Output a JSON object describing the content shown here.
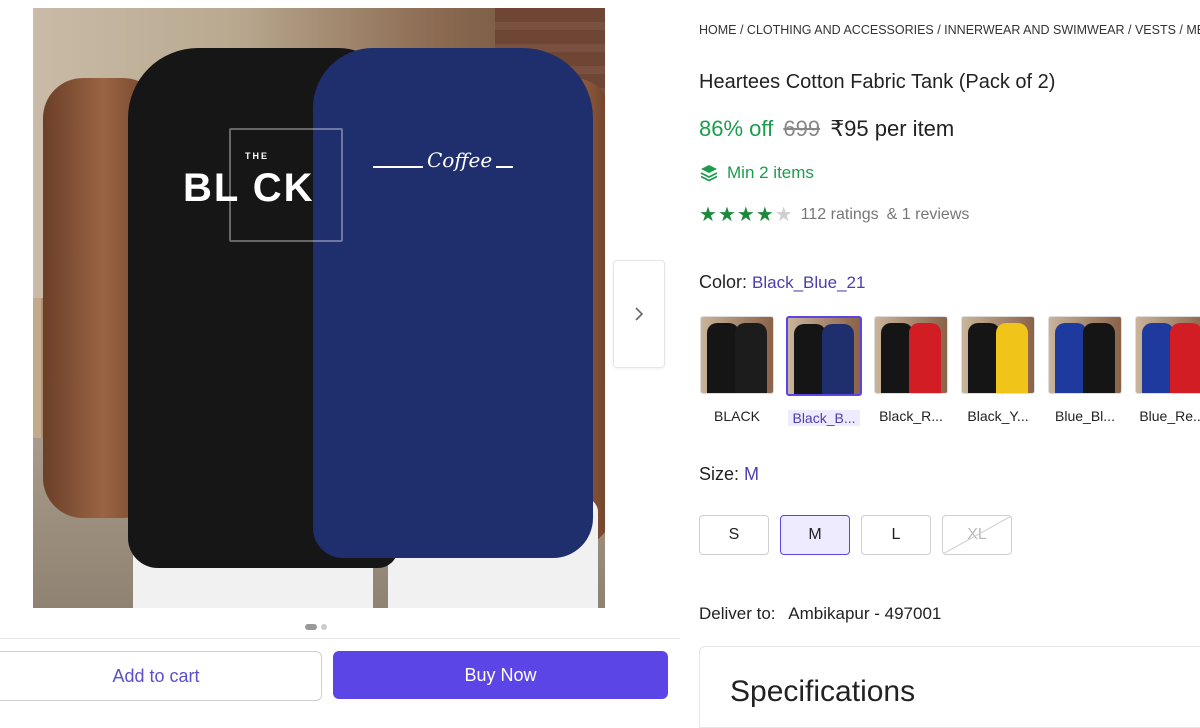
{
  "gallery": {
    "prints": {
      "black_word": "BL CK",
      "black_the": "THE",
      "blue_word": "Coffee"
    }
  },
  "actions": {
    "add_to_cart": "Add to cart",
    "buy_now": "Buy Now"
  },
  "product": {
    "breadcrumb": "HOME / CLOTHING AND ACCESSORIES / INNERWEAR AND SWIMWEAR / VESTS / ME",
    "title": "Heartees Cotton Fabric Tank (Pack of 2)",
    "discount": "86% off",
    "mrp": "699",
    "price": "₹95 per item",
    "min_items": "Min 2 items",
    "rating": {
      "value": 4,
      "max": 5,
      "ratings_text": "112 ratings",
      "reviews_text": "& 1 reviews"
    },
    "color": {
      "label": "Color:",
      "selected": "Black_Blue_21",
      "options": [
        {
          "caption": "BLACK",
          "c1": "#151515",
          "c2": "#1c1c1c",
          "selected": false
        },
        {
          "caption": "Black_B...",
          "c1": "#151515",
          "c2": "#1f2f6e",
          "selected": true
        },
        {
          "caption": "Black_R...",
          "c1": "#151515",
          "c2": "#d11d23",
          "selected": false
        },
        {
          "caption": "Black_Y...",
          "c1": "#151515",
          "c2": "#f0c419",
          "selected": false
        },
        {
          "caption": "Blue_Bl...",
          "c1": "#1f3a9e",
          "c2": "#151515",
          "selected": false
        },
        {
          "caption": "Blue_Re...",
          "c1": "#1f3a9e",
          "c2": "#d11d23",
          "selected": false
        }
      ]
    },
    "size": {
      "label": "Size:",
      "selected": "M",
      "options": [
        "S",
        "M",
        "L",
        "XL"
      ]
    },
    "delivery": {
      "label": "Deliver to:",
      "location": "Ambikapur - 497001"
    },
    "specifications_title": "Specifications"
  },
  "colors": {
    "accent": "#5b45e6",
    "discount_green": "#1c9c4d",
    "selection_text": "#4b3fb0"
  }
}
